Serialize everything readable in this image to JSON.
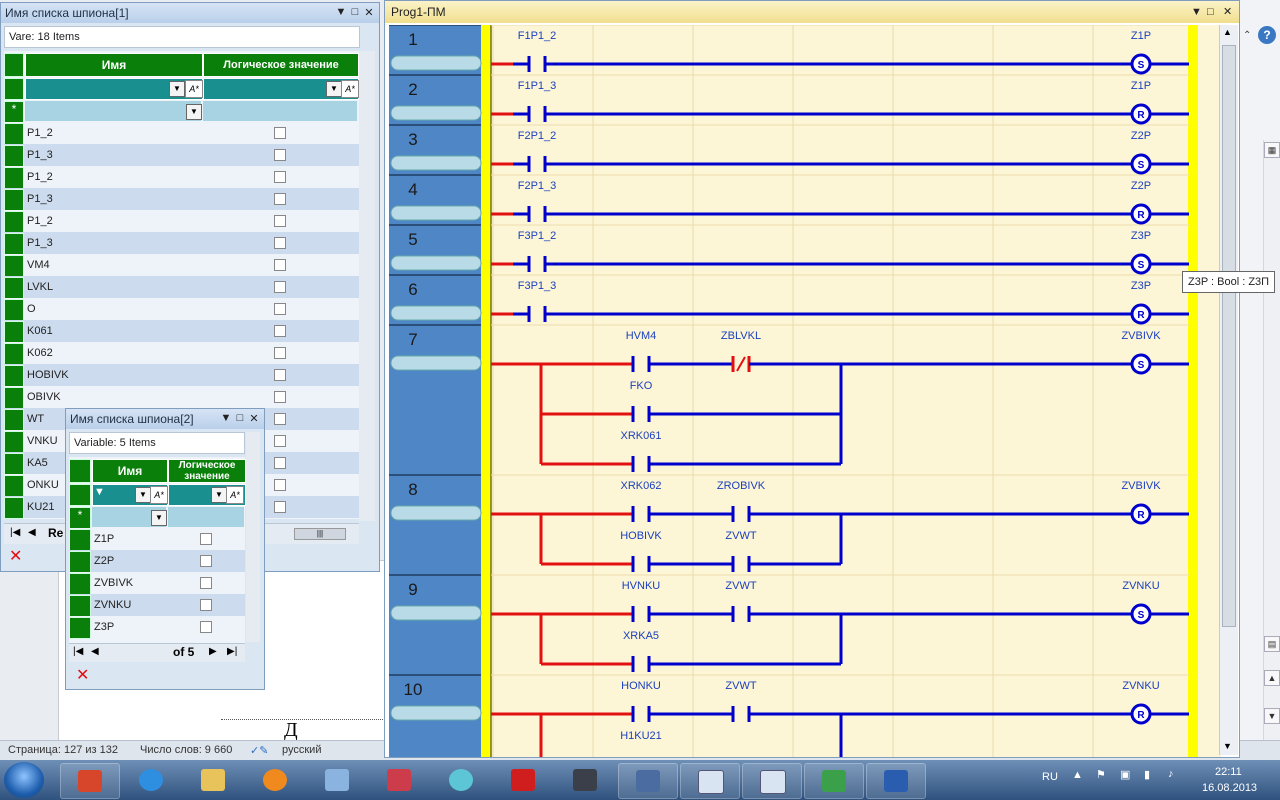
{
  "word": {
    "status_page": "Страница: 127 из 132",
    "status_words": "Число слов: 9 660",
    "status_lang": "русский",
    "help_glyph": "?",
    "page_glyph": "Д"
  },
  "spy1": {
    "title": "Имя списка шпиона[1]",
    "count": "Vare: 18 Items",
    "col_name": "Имя",
    "col_value": "Логическое значение",
    "filter_icon": "A*",
    "new_row_icon": "*",
    "rows": [
      "P1_2",
      "P1_3",
      "P1_2",
      "P1_3",
      "P1_2",
      "P1_3",
      "VM4",
      "LVKL",
      "O",
      "K061",
      "K062",
      "HOBIVK",
      "OBIVK",
      "WT",
      "VNKU",
      "KA5",
      "ONKU",
      "KU21"
    ],
    "nav_label": "Re"
  },
  "spy2": {
    "title": "Имя списка шпиона[2]",
    "count": "Variable: 5 Items",
    "col_name": "Имя",
    "col_value": "Логическое значение",
    "filter_icon": "A*",
    "new_row_icon": "*",
    "rows": [
      "Z1P",
      "Z2P",
      "ZVBIVK",
      "ZVNKU",
      "Z3P"
    ],
    "nav_label": "of 5"
  },
  "prog": {
    "title": "Prog1-ПМ",
    "tooltip": "Z3P : Bool : Z3П",
    "rungs": [
      {
        "num": "1",
        "contact": "F1P1_2",
        "coil": "Z1P",
        "coil_type": "S"
      },
      {
        "num": "2",
        "contact": "F1P1_3",
        "coil": "Z1P",
        "coil_type": "R"
      },
      {
        "num": "3",
        "contact": "F2P1_2",
        "coil": "Z2P",
        "coil_type": "S"
      },
      {
        "num": "4",
        "contact": "F2P1_3",
        "coil": "Z2P",
        "coil_type": "R"
      },
      {
        "num": "5",
        "contact": "F3P1_2",
        "coil": "Z3P",
        "coil_type": "S"
      },
      {
        "num": "6",
        "contact": "F3P1_3",
        "coil": "Z3P",
        "coil_type": "R"
      }
    ],
    "rung7": {
      "num": "7",
      "a": "HVM4",
      "b": "ZBLVKL",
      "c": "FKO",
      "d": "XRK061",
      "coil": "ZVBIVK",
      "coil_type": "S"
    },
    "rung8": {
      "num": "8",
      "a": "XRK062",
      "b": "ZROBIVK",
      "c": "HOBIVK",
      "d": "ZVWT",
      "coil": "ZVBIVK",
      "coil_type": "R"
    },
    "rung9": {
      "num": "9",
      "a": "HVNKU",
      "b": "ZVWT",
      "c": "XRKA5",
      "coil": "ZVNKU",
      "coil_type": "S"
    },
    "rung10": {
      "num": "10",
      "a": "HONKU",
      "b": "ZVWT",
      "c": "H1KU21",
      "coil": "ZVNKU",
      "coil_type": "R"
    }
  },
  "tray": {
    "lang": "RU",
    "time": "22:11",
    "date": "16.08.2013"
  },
  "colors": {
    "wire": "#0000cc",
    "energized": "#e21010",
    "rail": "#ffff00",
    "green": "#0a7f0a"
  }
}
